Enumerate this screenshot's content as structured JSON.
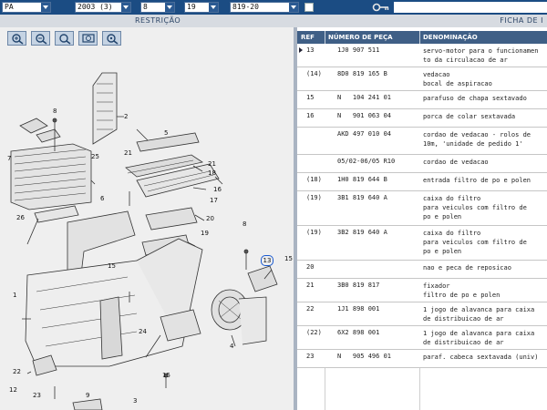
{
  "filters": {
    "market": "PA",
    "year": "2003 (3)",
    "group": "8",
    "subgroup": "19",
    "code": "819-20"
  },
  "section": {
    "left_title": "RESTRIÇÃO",
    "right_title": "FICHA DE I"
  },
  "toolbar": {
    "zoom_buttons": [
      "zoom-in-icon",
      "zoom-out-icon",
      "zoom-fit-icon",
      "zoom-window-icon",
      "zoom-area-icon"
    ]
  },
  "diagram": {
    "labels": [
      "8",
      "2",
      "25",
      "5",
      "21",
      "21",
      "18",
      "16",
      "17",
      "7",
      "6",
      "26",
      "20",
      "19",
      "8",
      "13",
      "15",
      "15",
      "1",
      "24",
      "4",
      "22",
      "15",
      "23",
      "9",
      "3",
      "12"
    ],
    "highlight_label": "13"
  },
  "table": {
    "headers": {
      "ref": "REF",
      "num": "NÚMERO DE PEÇA",
      "desc": "DENOMINAÇÃO"
    },
    "rows": [
      {
        "ref": "13",
        "num": "1J0 907 511",
        "desc": "servo-motor para o funcionamen\nto da circulacao de ar"
      },
      {
        "ref": "(14)",
        "num": "8D0 819 165 B",
        "desc": "vedacao\nbocal de aspiracao"
      },
      {
        "ref": "15",
        "num": "N   104 241 01",
        "desc": "parafuso de chapa sextavado"
      },
      {
        "ref": "16",
        "num": "N   901 063 04",
        "desc": "porca de colar sextavada"
      },
      {
        "ref": "",
        "num": "AKD 497 010 04",
        "desc": "cordao de vedacao - rolos de\n10m, 'unidade de pedido 1'"
      },
      {
        "ref": "",
        "num": "05/02-06/05 R10",
        "desc": "cordao de vedacao"
      },
      {
        "ref": "(18)",
        "num": "1H0 819 644 B",
        "desc": "entrada filtro de po e polen"
      },
      {
        "ref": "(19)",
        "num": "3B1 819 640 A",
        "desc": "caixa do filtro\npara veiculos com filtro de\npo e polen"
      },
      {
        "ref": "(19)",
        "num": "3B2 819 640 A",
        "desc": "caixa do filtro\npara veiculos com filtro de\npo e polen"
      },
      {
        "ref": "20",
        "num": "",
        "desc": "nao e peca de reposicao"
      },
      {
        "ref": "21",
        "num": "3B0 819 817",
        "desc": "fixador\nfiltro de po e polen"
      },
      {
        "ref": "22",
        "num": "1J1 898 001",
        "desc": "1 jogo de alavanca para caixa\nde distribuicao de ar"
      },
      {
        "ref": "(22)",
        "num": "6X2 898 001",
        "desc": "1 jogo de alavanca para caixa\nde distribuicao de ar"
      },
      {
        "ref": "23",
        "num": "N   905 496 01",
        "desc": "paraf. cabeca sextavada (univ)"
      }
    ]
  }
}
